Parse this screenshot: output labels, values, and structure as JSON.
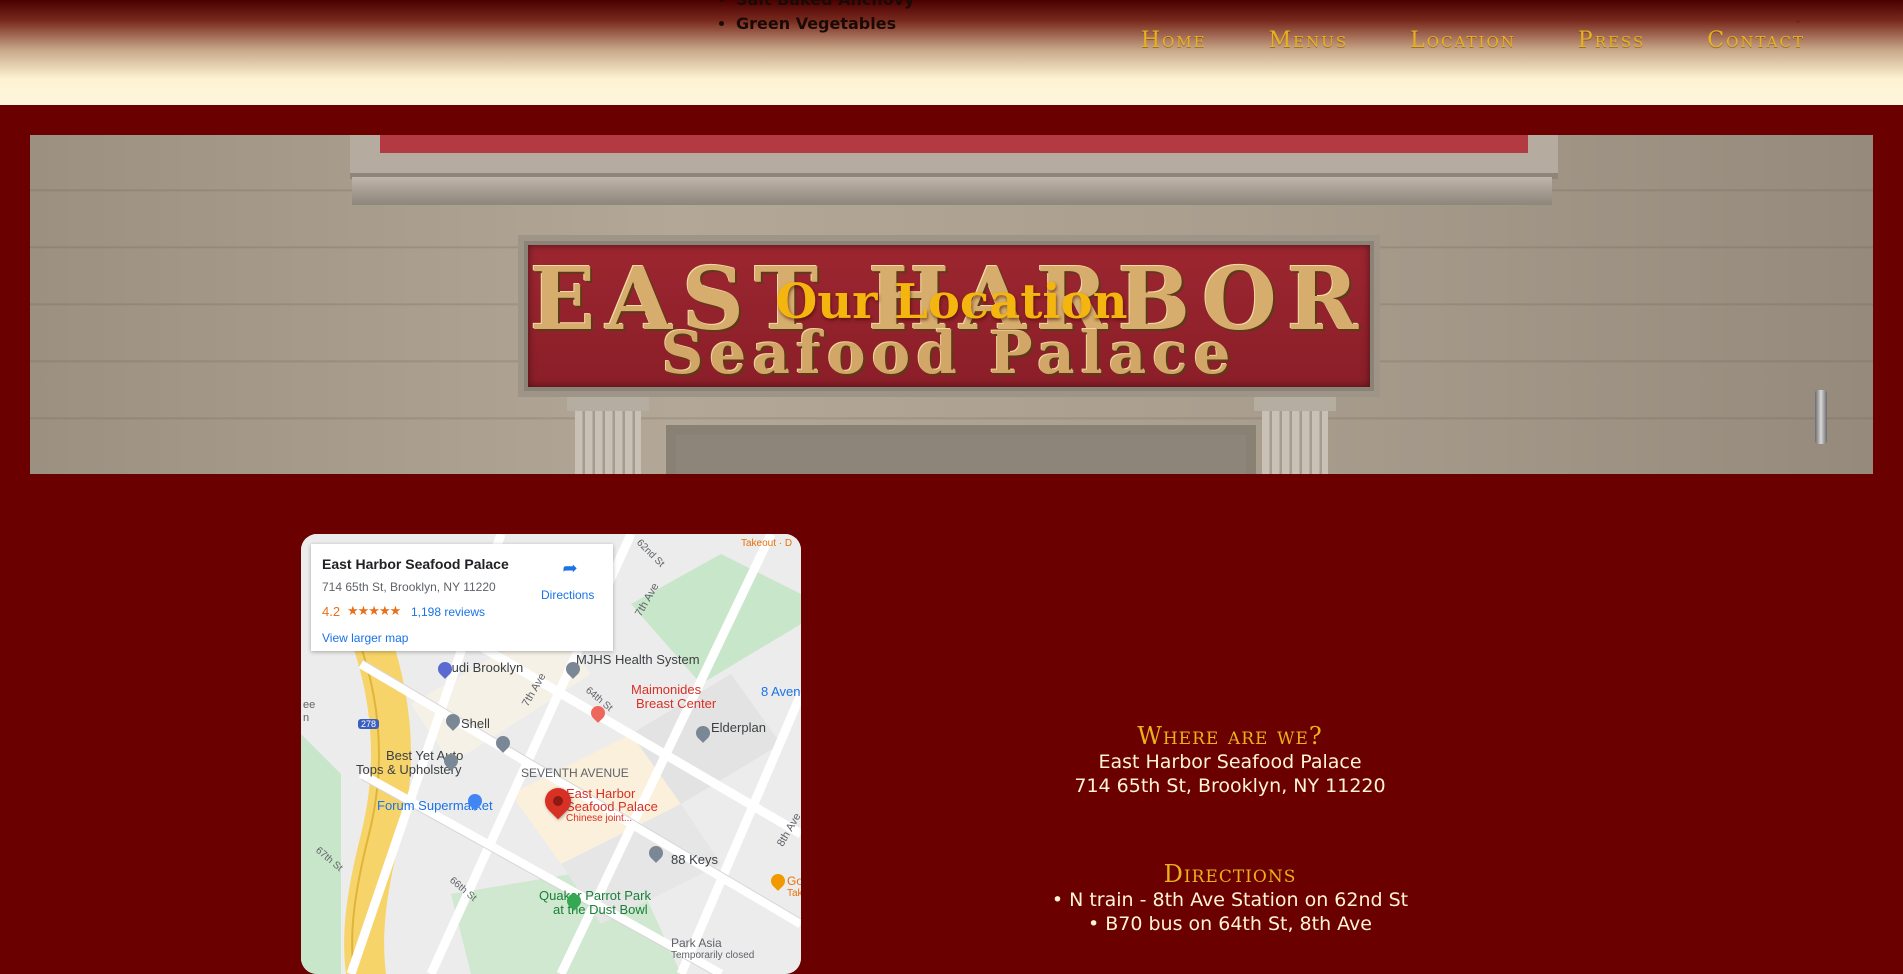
{
  "header": {
    "peek_items": [
      "Salt Baked Anchovy",
      "Green Vegetables"
    ],
    "nav": [
      "Home",
      "Menus",
      "Location",
      "Press",
      "Contact"
    ]
  },
  "hero": {
    "title": "Our Location",
    "sign_line1": "EAST HARBOR",
    "sign_line2": "Seafood Palace"
  },
  "map": {
    "card": {
      "name": "East Harbor Seafood Palace",
      "address": "714 65th St, Brooklyn, NY 11220",
      "rating": "4.2",
      "stars": "★★★★★",
      "reviews": "1,198 reviews",
      "larger_map": "View larger map",
      "directions": "Directions"
    },
    "labels": {
      "audi": "Audi Brooklyn",
      "mjhs": "MJHS Health System",
      "maimonides_1": "Maimonides",
      "maimonides_2": "Breast Center",
      "ave8_right": "8 Aven",
      "shell": "Shell",
      "elderplan": "Elderplan",
      "bestyet_1": "Best Yet Auto",
      "bestyet_2": "Tops & Upholstery",
      "seventh": "SEVENTH AVENUE",
      "forum": "Forum Supermarket",
      "pin_1": "East Harbor",
      "pin_2": "Seafood Palace",
      "pin_3": "Chinese joint...",
      "keys": "88 Keys",
      "quaker_1": "Quaker Parrot Park",
      "quaker_2": "at the Dust Bowl",
      "parkasia_1": "Park Asia",
      "parkasia_2": "Temporarily closed",
      "takeout": "Takeout · D",
      "go": "Go",
      "tak": "Tak",
      "st62": "62nd St",
      "ave7a": "7th Ave",
      "ave7b": "7th Ave",
      "st64": "64th St",
      "ave8": "8th Ave",
      "st67": "67th St",
      "st66": "66th St",
      "shield": "278",
      "edge_ee": "ee",
      "edge_n": "n"
    }
  },
  "info": {
    "where_heading": "Where are we?",
    "name": "East Harbor Seafood Palace",
    "address": "714 65th St, Brooklyn, NY 11220",
    "directions_heading": "Directions",
    "directions": [
      "N train - 8th Ave Station on 62nd St",
      "B70 bus on 64th St, 8th Ave"
    ]
  },
  "colors": {
    "background": "#6b0000",
    "accent_gold": "#e9b21a",
    "title_gold": "#f4b60e",
    "text_cream": "#fff3d6",
    "map_pin_red": "#d93025",
    "map_link_blue": "#1a73e8"
  },
  "icons": [
    "directions-icon",
    "map-pin-icon",
    "shopping-cart-icon",
    "gas-station-icon",
    "tree-icon",
    "restaurant-icon",
    "location-pin-icon",
    "scroll-caret-icon"
  ]
}
